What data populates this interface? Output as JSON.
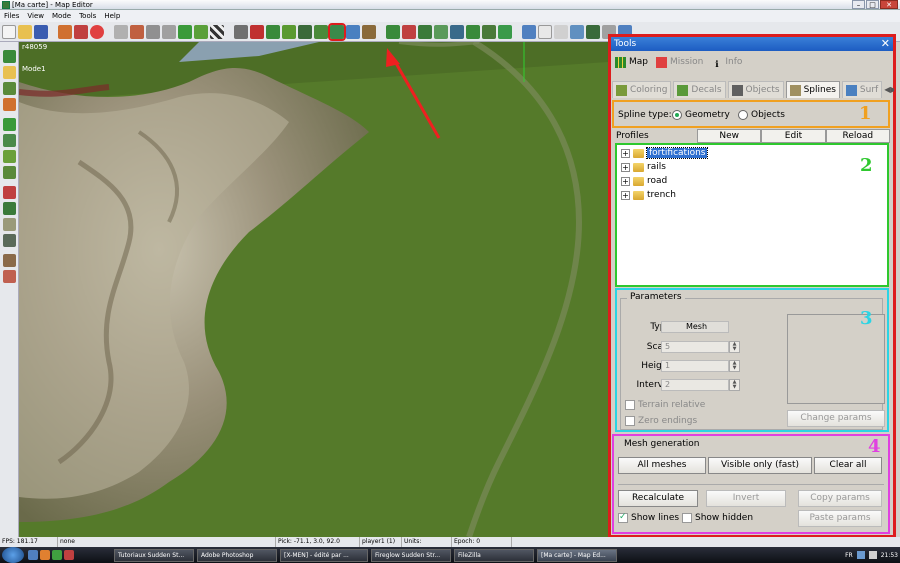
{
  "window": {
    "title": "[Ma carte] - Map Editor",
    "controls": [
      "–",
      "□",
      "✕"
    ]
  },
  "menu": [
    "Files",
    "View",
    "Mode",
    "Tools",
    "Help"
  ],
  "viewport": {
    "object_id": "r48059",
    "mode": "Mode1"
  },
  "toolbar": {
    "highlighted_button": "splines-tool-button",
    "highlight_color": "#dd1d1d"
  },
  "panel": {
    "title": "Tools",
    "close": "✕",
    "tabs": [
      {
        "label": "Map",
        "active": true,
        "icon": "grid-icon"
      },
      {
        "label": "Mission",
        "active": false,
        "icon": "mission-icon"
      },
      {
        "label": "Info",
        "active": false,
        "icon": "info-icon"
      }
    ],
    "subtabs": [
      {
        "label": "Coloring",
        "active": false
      },
      {
        "label": "Decals",
        "active": false
      },
      {
        "label": "Objects",
        "active": false
      },
      {
        "label": "Splines",
        "active": true
      },
      {
        "label": "Surf",
        "active": false
      }
    ],
    "section1": {
      "number": "1",
      "label": "Spline type:",
      "options": [
        {
          "label": "Geometry",
          "selected": true
        },
        {
          "label": "Objects",
          "selected": false
        }
      ]
    },
    "profiles": {
      "label": "Profiles",
      "buttons": [
        "New",
        "Edit",
        "Reload"
      ]
    },
    "section2": {
      "number": "2",
      "items": [
        "fortifications",
        "rails",
        "road",
        "trench"
      ],
      "selected_index": 0
    },
    "section3": {
      "number": "3",
      "title": "Parameters",
      "type_label": "Type",
      "type_value": "Mesh",
      "scale_label": "Scale",
      "scale_value": "5",
      "height_label": "Height",
      "height_value": "1",
      "interval_label": "Interval",
      "interval_value": "2",
      "terrain_relative": "Terrain relative",
      "zero_endings": "Zero endings",
      "change_params": "Change params"
    },
    "section4": {
      "number": "4",
      "title": "Mesh generation",
      "all_meshes": "All meshes",
      "visible_only": "Visible only (fast)",
      "clear_all": "Clear all",
      "recalculate": "Recalculate",
      "invert": "Invert",
      "copy_params": "Copy params",
      "paste_params": "Paste params",
      "show_lines": "Show lines",
      "show_lines_checked": true,
      "show_hidden": "Show hidden",
      "show_hidden_checked": false
    },
    "section_colors": {
      "1": "#f0a020",
      "2": "#2ec82e",
      "3": "#2ad4e4",
      "4": "#e040e0"
    }
  },
  "status": {
    "fps": "FPS: 181.17",
    "selection": "none",
    "pick": "Pick: -71.1, 3.0, 92.0",
    "player": "player1 (1)",
    "units": "Units:",
    "epoch": "Epoch: 0"
  },
  "taskbar": {
    "items": [
      "Tutoriaux Sudden St...",
      "Adobe Photoshop",
      "[X-MEN] - édité par ...",
      "Fireglow Sudden Str...",
      "FileZilla",
      "[Ma carte] - Map Ed..."
    ],
    "active_index": 5,
    "lang": "FR",
    "time": "21:53"
  }
}
